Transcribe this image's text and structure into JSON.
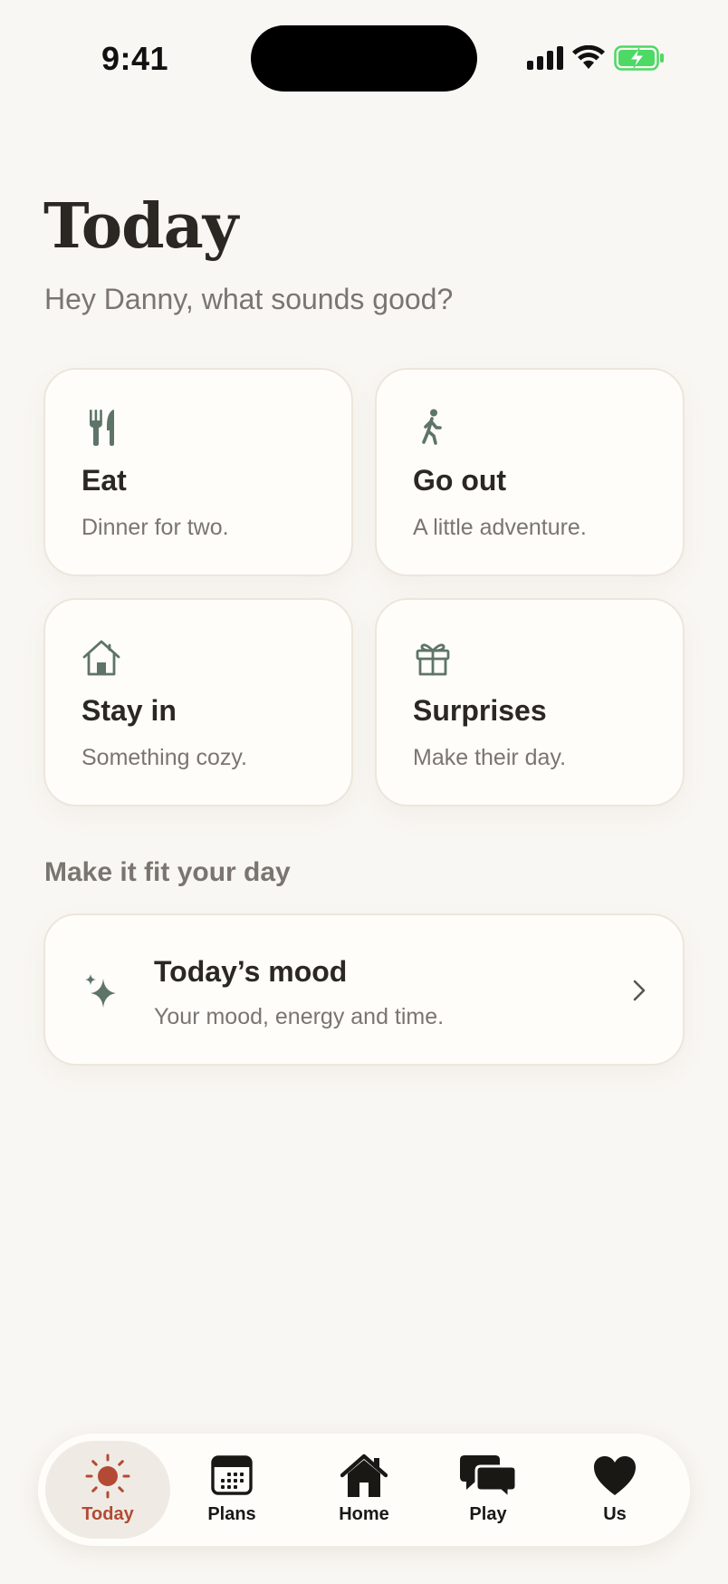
{
  "status_bar": {
    "time": "9:41"
  },
  "header": {
    "title": "Today",
    "subtitle": "Hey Danny, what sounds good?"
  },
  "categories": [
    {
      "title": "Eat",
      "desc": "Dinner for two.",
      "icon": "fork-knife-icon"
    },
    {
      "title": "Go out",
      "desc": "A little adventure.",
      "icon": "walking-person-icon"
    },
    {
      "title": "Stay in",
      "desc": "Something cozy.",
      "icon": "house-icon"
    },
    {
      "title": "Surprises",
      "desc": "Make their day.",
      "icon": "gift-icon"
    }
  ],
  "section": {
    "label": "Make it fit your day"
  },
  "mood": {
    "title": "Today’s mood",
    "desc": "Your mood, energy and time.",
    "icon": "sparkles-icon"
  },
  "tabs": [
    {
      "label": "Today",
      "icon": "sun-icon",
      "active": true
    },
    {
      "label": "Plans",
      "icon": "calendar-icon",
      "active": false
    },
    {
      "label": "Home",
      "icon": "house-icon",
      "active": false
    },
    {
      "label": "Play",
      "icon": "chat-bubbles-icon",
      "active": false
    },
    {
      "label": "Us",
      "icon": "heart-icon",
      "active": false
    }
  ],
  "colors": {
    "background": "#F9F7F3",
    "card": "#FEFDFA",
    "accent": "#B34A35",
    "icon_green": "#5E7468",
    "text_primary": "#2B2823",
    "text_secondary": "#7A7570",
    "battery_green": "#4CD964"
  }
}
